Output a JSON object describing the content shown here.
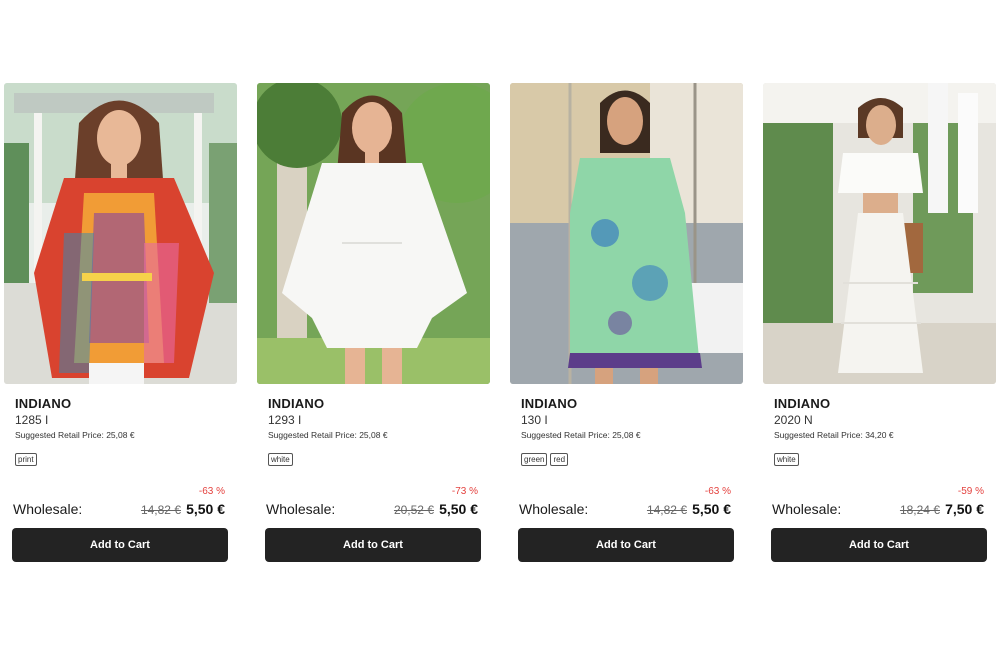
{
  "products": [
    {
      "brand": "INDIANO",
      "code": "1285 I",
      "srp": "Suggested Retail Price: 25,08 €",
      "tags": [
        "print"
      ],
      "discount": "-63 %",
      "wholesale_label": "Wholesale:",
      "old_price": "14,82 €",
      "new_price": "5,50 €",
      "cart_label": "Add to Cart",
      "image_name": "product-photo-patterned-kaftan"
    },
    {
      "brand": "INDIANO",
      "code": "1293 I",
      "srp": "Suggested Retail Price: 25,08 €",
      "tags": [
        "white"
      ],
      "discount": "-73 %",
      "wholesale_label": "Wholesale:",
      "old_price": "20,52 €",
      "new_price": "5,50 €",
      "cart_label": "Add to Cart",
      "image_name": "product-photo-white-tunic"
    },
    {
      "brand": "INDIANO",
      "code": "130 I",
      "srp": "Suggested Retail Price: 25,08 €",
      "tags": [
        "green",
        "red"
      ],
      "discount": "-63 %",
      "wholesale_label": "Wholesale:",
      "old_price": "14,82 €",
      "new_price": "5,50 €",
      "cart_label": "Add to Cart",
      "image_name": "product-photo-green-print-dress"
    },
    {
      "brand": "INDIANO",
      "code": "2020 N",
      "srp": "Suggested Retail Price: 34,20 €",
      "tags": [
        "white"
      ],
      "discount": "-59 %",
      "wholesale_label": "Wholesale:",
      "old_price": "18,24 €",
      "new_price": "7,50 €",
      "cart_label": "Add to Cart",
      "image_name": "product-photo-white-top-skirt-set"
    }
  ],
  "colors": {
    "discount": "#e4423f",
    "button_bg": "#232323",
    "button_text": "#ffffff"
  }
}
